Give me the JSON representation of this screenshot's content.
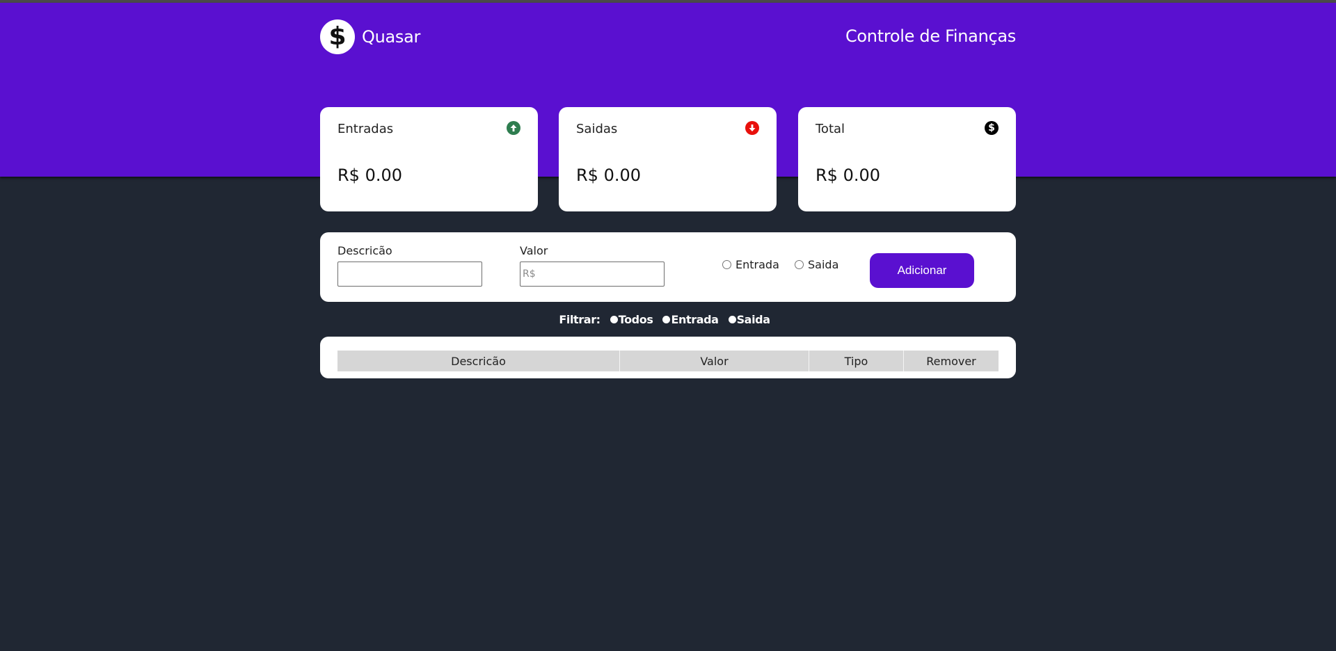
{
  "header": {
    "brand_icon": "$",
    "brand_name": "Quasar",
    "title": "Controle de Finanças",
    "background_color": "#5a10d0"
  },
  "cards": {
    "income": {
      "title": "Entradas",
      "value": "R$ 0.00",
      "icon": "arrow-up-circle-icon",
      "icon_color": "#2e7d4f"
    },
    "expense": {
      "title": "Saidas",
      "value": "R$ 0.00",
      "icon": "arrow-down-circle-icon",
      "icon_color": "#e8100c"
    },
    "total": {
      "title": "Total",
      "value": "R$ 0.00",
      "icon": "dollar-circle-icon",
      "icon_color": "#000000"
    }
  },
  "form": {
    "description_label": "Descricão",
    "description_value": "",
    "value_label": "Valor",
    "value_placeholder": "R$",
    "type_options": [
      "Entrada",
      "Saida"
    ],
    "add_button_label": "Adicionar"
  },
  "filter": {
    "label": "Filtrar:",
    "options": [
      "Todos",
      "Entrada",
      "Saida"
    ]
  },
  "table": {
    "columns": [
      "Descricão",
      "Valor",
      "Tipo",
      "Remover"
    ],
    "rows": []
  }
}
